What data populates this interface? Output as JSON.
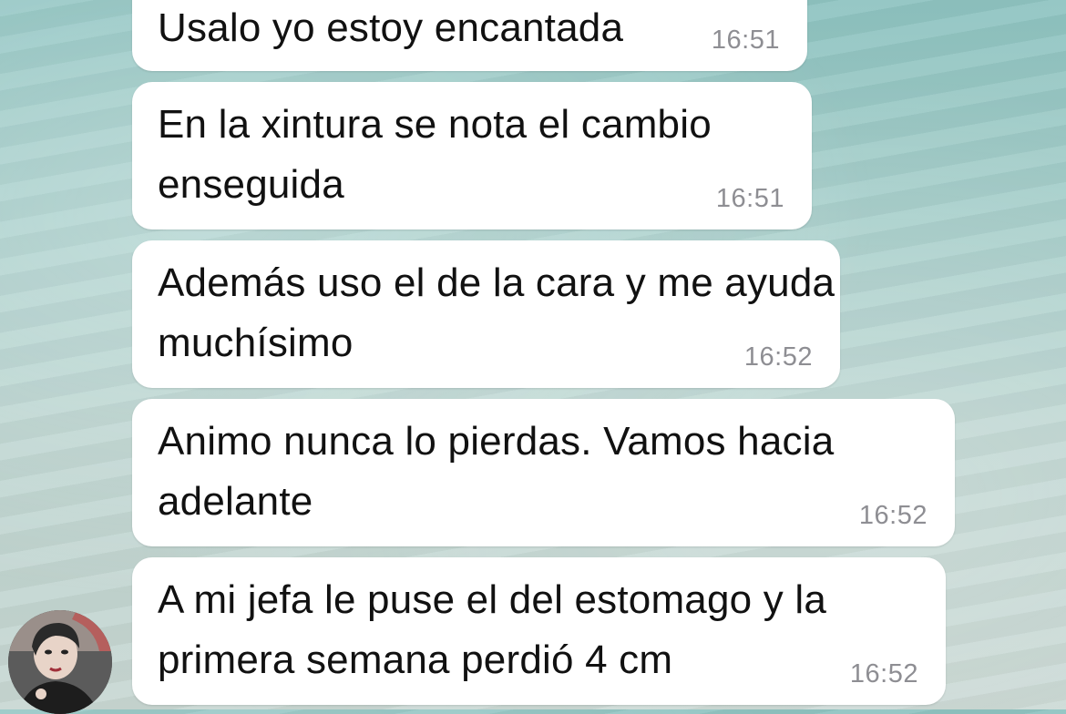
{
  "conversation": {
    "messages": [
      {
        "text": "Usalo yo estoy encantada",
        "time": "16:51"
      },
      {
        "text": "En la xintura se nota el cambio\nenseguida",
        "time": "16:51"
      },
      {
        "text": "Además uso el de la cara y me ayuda\nmuchísimo",
        "time": "16:52"
      },
      {
        "text": "Animo nunca lo pierdas. Vamos hacia\nadelante",
        "time": "16:52"
      },
      {
        "text": "A mi jefa le puse el del estomago y la\nprimera semana perdió 4 cm",
        "time": "16:52"
      }
    ]
  },
  "sender": {
    "avatar_icon": "profile-photo"
  },
  "colors": {
    "bubble": "#ffffff",
    "timestamp": "#8e8e93",
    "text": "#111111"
  }
}
